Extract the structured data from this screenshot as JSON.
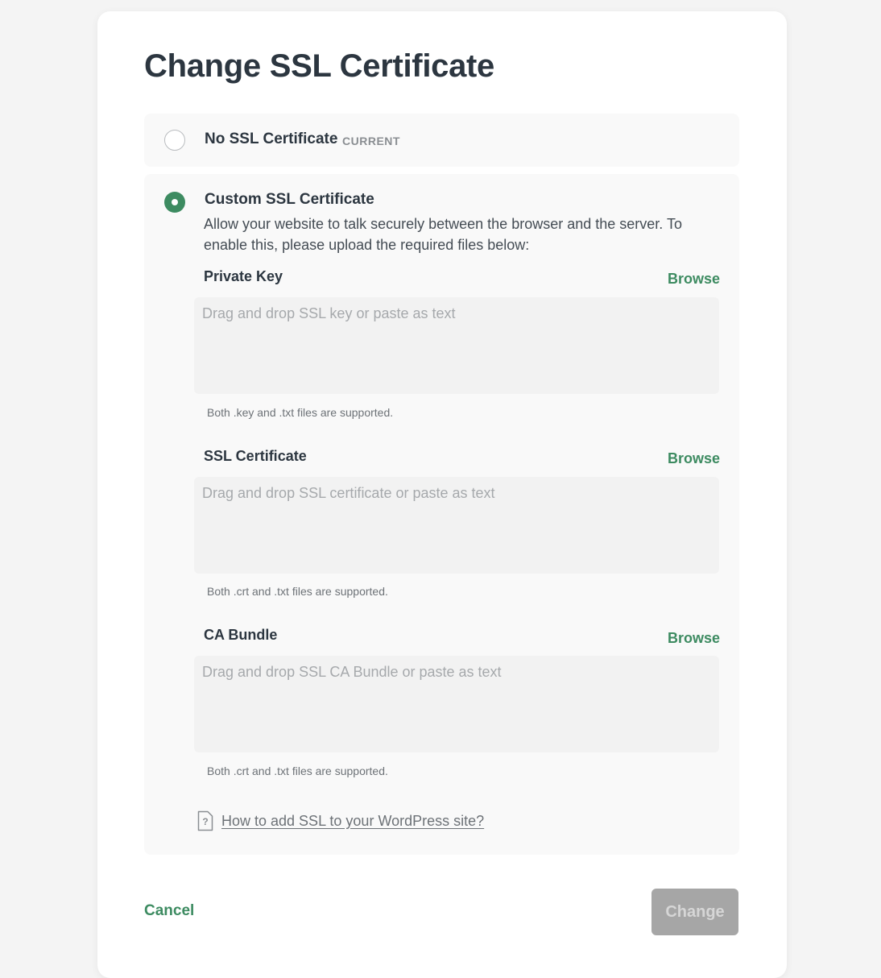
{
  "dialog": {
    "title": "Change SSL Certificate"
  },
  "options": {
    "none": {
      "label": "No SSL Certificate",
      "badge": "CURRENT",
      "selected": false
    },
    "custom": {
      "label": "Custom SSL Certificate",
      "description": "Allow your website to talk securely between the browser and the server. To enable this, please upload the required files below:",
      "selected": true
    }
  },
  "fields": {
    "private_key": {
      "label": "Private Key",
      "browse": "Browse",
      "placeholder": "Drag and drop SSL key or paste as text",
      "hint": "Both .key and .txt files are supported."
    },
    "certificate": {
      "label": "SSL Certificate",
      "browse": "Browse",
      "placeholder": "Drag and drop SSL certificate or paste as text",
      "hint": "Both .crt and .txt files are supported."
    },
    "ca_bundle": {
      "label": "CA Bundle",
      "browse": "Browse",
      "placeholder": "Drag and drop SSL CA Bundle or paste as text",
      "hint": "Both .crt and .txt files are supported."
    }
  },
  "help": {
    "icon": "document-question-icon",
    "link": "How to add SSL to your WordPress site?"
  },
  "footer": {
    "cancel": "Cancel",
    "submit": "Change"
  },
  "colors": {
    "accent": "#3d8b61",
    "disabled_button": "#a6a6a6"
  }
}
